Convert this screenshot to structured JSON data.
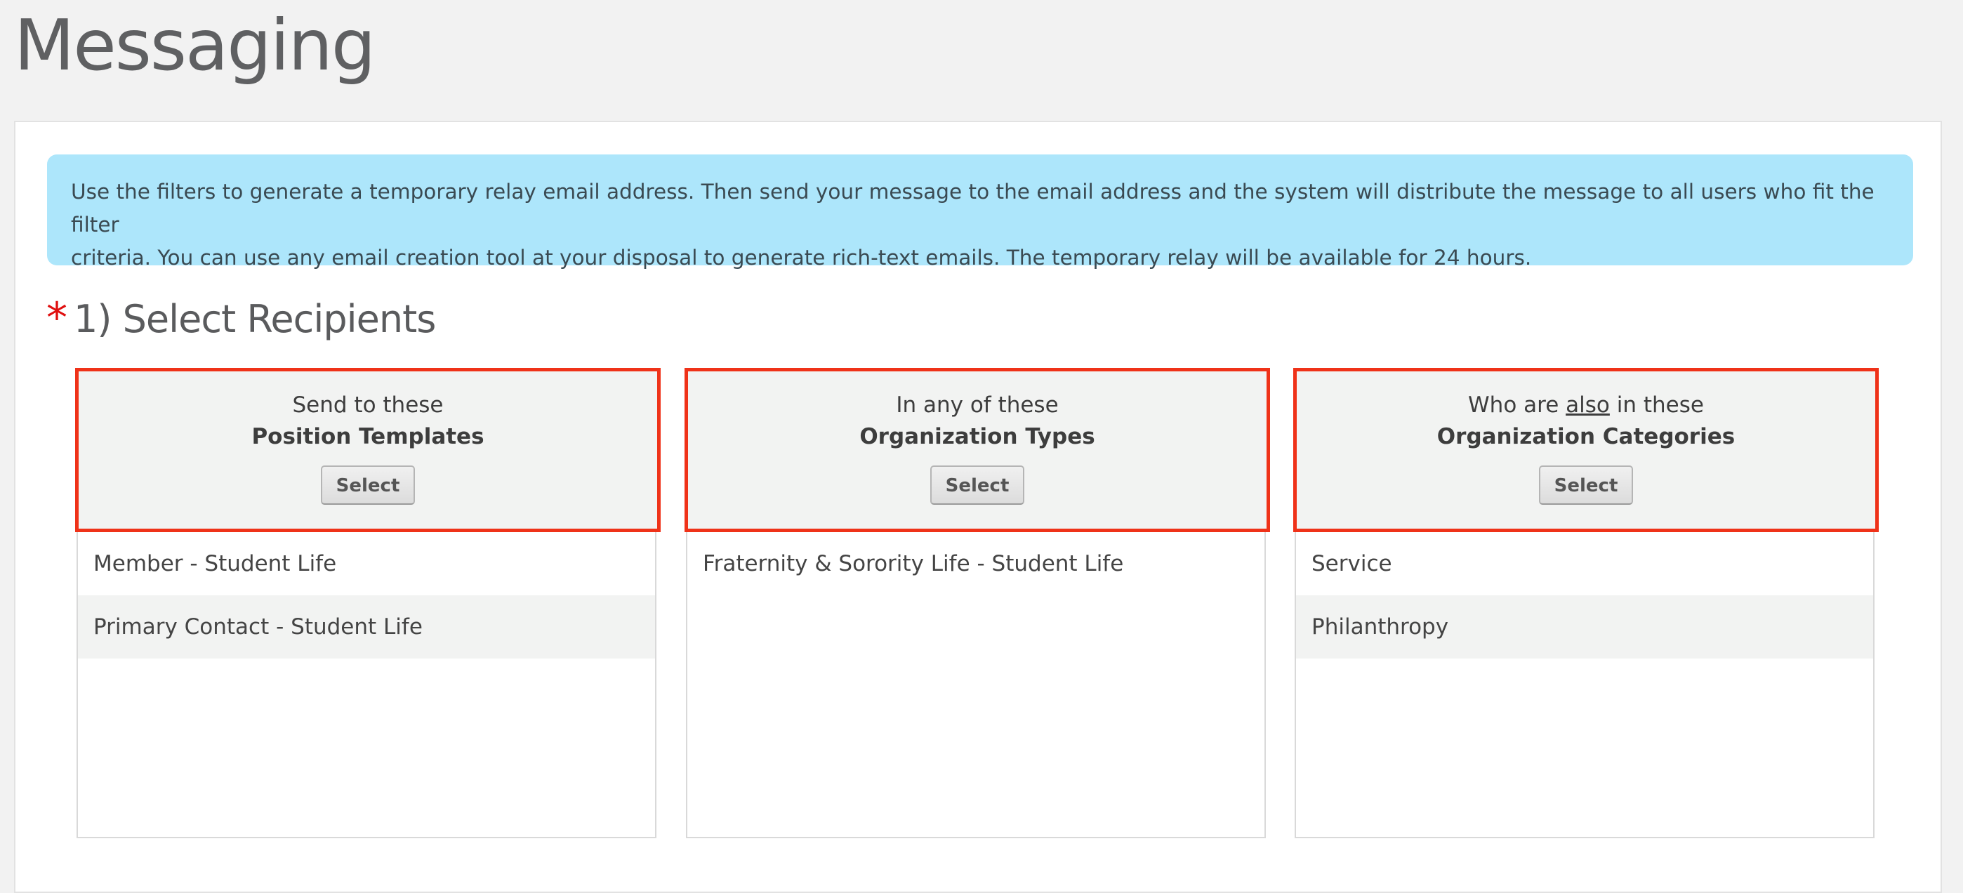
{
  "page": {
    "title": "Messaging"
  },
  "info": {
    "line1": "Use the filters to generate a temporary relay email address. Then send your message to the email address and the system will distribute the message to all users who fit the filter",
    "line2": "criteria. You can use any email creation tool at your disposal to generate rich-text emails. The temporary relay will be available for 24 hours."
  },
  "recipients": {
    "required_marker": "*",
    "heading": "1) Select Recipients",
    "filters": [
      {
        "intro_before": "Send to these",
        "intro_emphasis": "",
        "intro_after": "",
        "title": "Position Templates",
        "button": "Select",
        "items": [
          "Member - Student Life",
          "Primary Contact - Student Life"
        ]
      },
      {
        "intro_before": "In any of these",
        "intro_emphasis": "",
        "intro_after": "",
        "title": "Organization Types",
        "button": "Select",
        "items": [
          "Fraternity & Sorority Life - Student Life"
        ]
      },
      {
        "intro_before": "Who are ",
        "intro_emphasis": "also",
        "intro_after": " in these",
        "title": "Organization Categories",
        "button": "Select",
        "items": [
          "Service",
          "Philanthropy"
        ]
      }
    ]
  },
  "colors": {
    "highlight_border": "#ef3219",
    "info_background": "#ade6fb",
    "required_star": "#e01010"
  }
}
